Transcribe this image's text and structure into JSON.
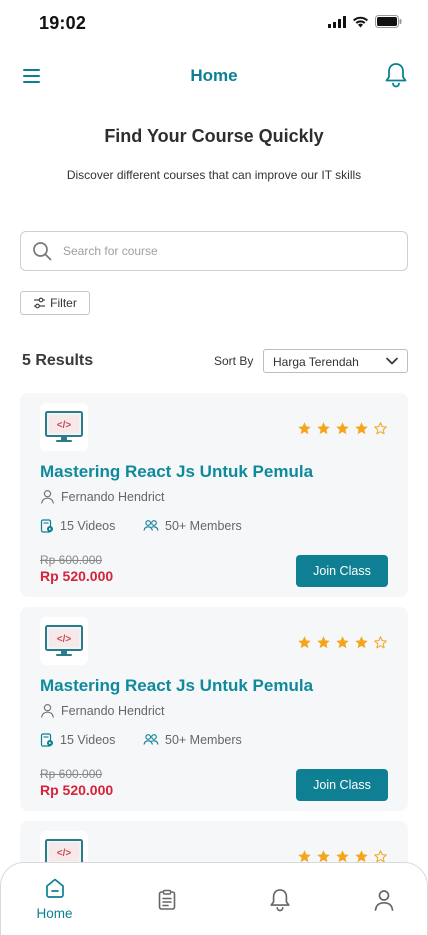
{
  "status_bar": {
    "time": "19:02"
  },
  "header": {
    "title": "Home"
  },
  "hero": {
    "title": "Find Your Course Quickly",
    "subtitle": "Discover different courses that can improve our IT skills"
  },
  "search": {
    "placeholder": "Search for course",
    "value": ""
  },
  "filter": {
    "label": "Filter"
  },
  "results": {
    "count_label": "5 Results",
    "sort_label": "Sort By",
    "sort_value": "Harga Terendah"
  },
  "courses": [
    {
      "title": "Mastering React Js Untuk Pemula",
      "instructor": "Fernando Hendrict",
      "videos": "15 Videos",
      "members": "50+ Members",
      "old_price": "Rp 600.000",
      "price": "Rp 520.000",
      "rating": 4,
      "max_rating": 5,
      "join_label": "Join Class"
    },
    {
      "title": "Mastering React Js Untuk Pemula",
      "instructor": "Fernando Hendrict",
      "videos": "15 Videos",
      "members": "50+ Members",
      "old_price": "Rp 600.000",
      "price": "Rp 520.000",
      "rating": 4,
      "max_rating": 5,
      "join_label": "Join Class"
    },
    {
      "rating": 4,
      "max_rating": 5
    }
  ],
  "bottom_nav": {
    "items": [
      {
        "label": "Home",
        "icon": "home-icon",
        "active": true
      },
      {
        "label": "",
        "icon": "clipboard-icon",
        "active": false
      },
      {
        "label": "",
        "icon": "bell-icon",
        "active": false
      },
      {
        "label": "",
        "icon": "user-icon",
        "active": false
      }
    ]
  },
  "colors": {
    "accent": "#0f8a9d",
    "button": "#0f7f93",
    "price": "#d6223a",
    "star": "#f4a51c",
    "card_bg": "#f6f7f8"
  }
}
